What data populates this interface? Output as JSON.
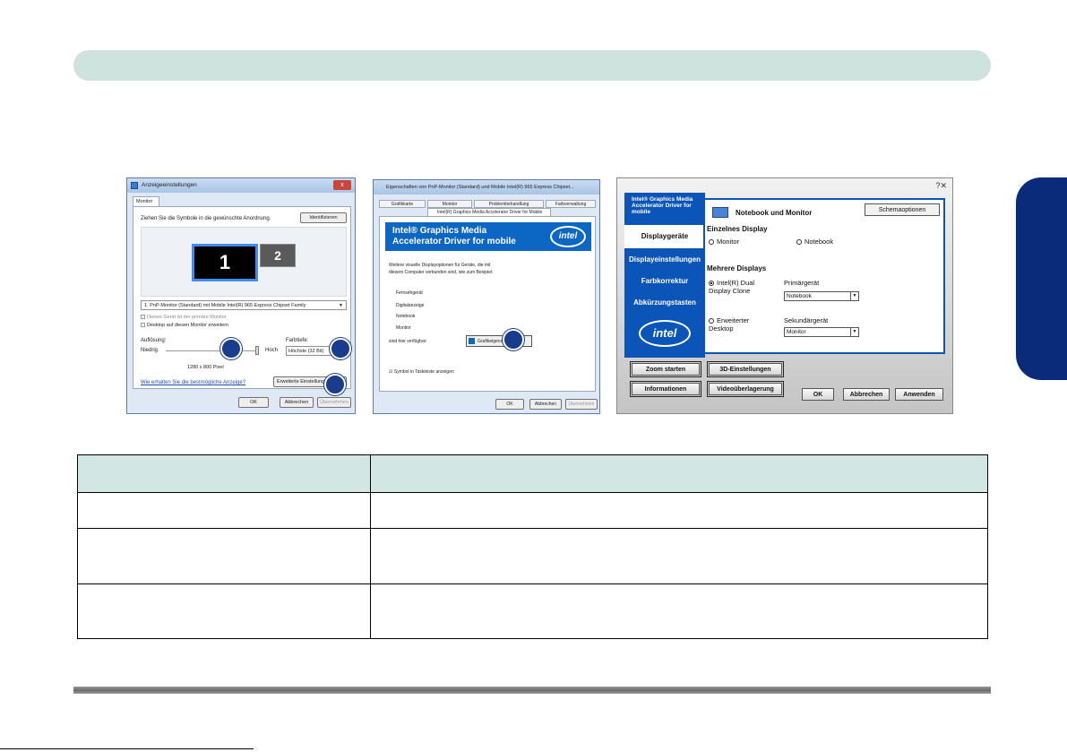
{
  "shot1": {
    "title": "Anzeigeeinstellungen",
    "close": "x",
    "tab": "Monitor",
    "instruction": "Ziehen Sie die Symbole in die gewünschte Anordnung.",
    "identify_button": "Identifizieren",
    "monitor1": "1",
    "monitor2": "2",
    "display_select": "1. PnP-Monitor (Standard) mit Mobile Intel(R) 965 Express Chipset Family",
    "primary_check": "Dieses Gerät ist der primäre Monitor",
    "extend_check": "Desktop auf diesen Monitor erweitern",
    "resolution_label": "Auflösung:",
    "low": "Niedrig",
    "high": "Hoch",
    "resolution_value": "1280 x 800 Pixel",
    "color_depth_label": "Farbtiefe:",
    "color_depth_value": "Höchste (32 Bit)",
    "help_link": "Wie erhalten Sie die bestmögliche Anzeige?",
    "advanced_button": "Erweiterte Einstellungen...",
    "ok": "OK",
    "cancel": "Abbrechen",
    "apply": "Übernehmen"
  },
  "shot2": {
    "title": "Eigenschaften von PnP-Monitor (Standard) und Mobile Intel(R) 965 Express Chipset...",
    "tabs": [
      "Grafikkarte",
      "Monitor",
      "Problembehandlung",
      "Farbverwaltung"
    ],
    "subtab": "Intel(R) Graphics Media Accelerator Driver for Mobile",
    "banner": "Intel® Graphics Media Accelerator Driver for mobile",
    "logo": "intel",
    "description": "Weitere visuelle Displayoptionen für Geräte, die mit diesem Computer verbunden sind, wie zum Beispiel:",
    "devices": [
      "Fernsehgerät",
      "Digitalanzeige",
      "Notebook",
      "Monitor"
    ],
    "available": "sind hier verfügbar:",
    "gfx_button": "Grafikeigenschaften...",
    "tray_check": "Symbol in Taskleiste anzeigen",
    "ok": "OK",
    "cancel": "Abbrechen",
    "apply": "Übernehmen"
  },
  "shot3": {
    "window_icons": "?✕",
    "brand": "Intel® Graphics Media Accelerator Driver for mobile",
    "nav": [
      "Displaygeräte",
      "Displayeinstellungen",
      "Farbkorrektur",
      "Abkürzungstasten"
    ],
    "logo": "intel",
    "main_title": "Notebook und Monitor",
    "schema_button": "Schemaoptionen",
    "single_display": "Einzelnes Display",
    "radio_monitor": "Monitor",
    "radio_notebook": "Notebook",
    "multiple_displays": "Mehrere Displays",
    "dual_clone": "Intel(R) Dual Display Clone",
    "extended_desktop": "Erweiterter Desktop",
    "primary_label": "Primärgerät",
    "primary_value": "Notebook",
    "secondary_label": "Sekundärgerät",
    "secondary_value": "Monitor",
    "zoom_button": "Zoom starten",
    "settings3d_button": "3D-Einstellungen",
    "info_button": "Informationen",
    "video_button": "Videoüberlagerung",
    "ok": "OK",
    "cancel": "Abbrechen",
    "apply": "Anwenden"
  }
}
